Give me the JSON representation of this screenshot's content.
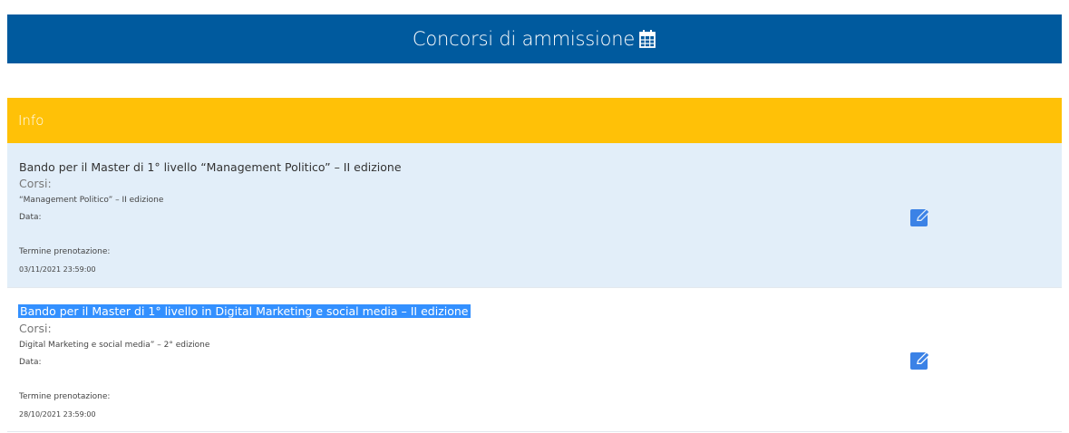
{
  "header": {
    "title": "Concorsi di ammissione",
    "icon": "calendar-icon"
  },
  "info": {
    "label": "Info"
  },
  "cards": [
    {
      "title": "Bando per il Master di 1° livello “Management Politico” – II edizione",
      "corsi_label": "Corsi:",
      "corso": "“Management Politico” – II edizione",
      "data_label": "Data:",
      "termine_label": "Termine prenotazione:",
      "termine_value": "03/11/2021 23:59:00",
      "action_icon": "edit-icon"
    },
    {
      "title": "Bando per il Master di 1° livello in Digital Marketing e social media – II edizione",
      "corsi_label": "Corsi:",
      "corso": "Digital Marketing e social media” – 2° edizione",
      "data_label": "Data:",
      "termine_label": "Termine prenotazione:",
      "termine_value": "28/10/2021 23:59:00",
      "action_icon": "edit-icon"
    }
  ],
  "colors": {
    "header_bg": "#005a9e",
    "info_bg": "#ffc107",
    "row_highlight": "#e2eef9",
    "edit_icon": "#3b82e6",
    "selection": "#3390ff"
  }
}
